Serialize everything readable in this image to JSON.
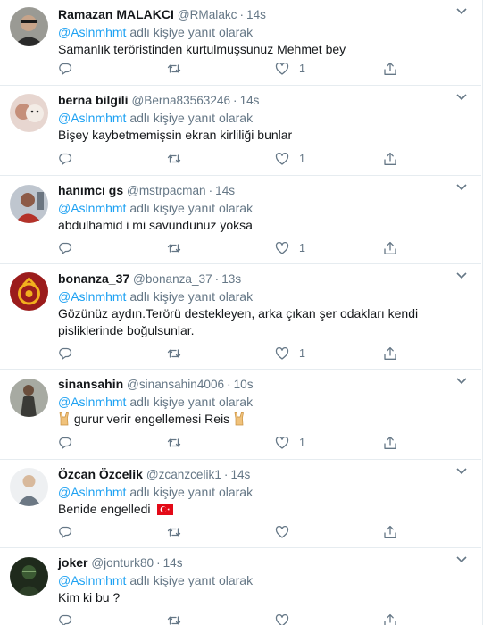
{
  "reply_prefix_suffix": "adlı kişiye yanıt olarak",
  "colors": {
    "accent": "#1da1f2",
    "muted": "#657786",
    "text": "#14171a",
    "divider": "#e6ecf0"
  },
  "tweets": [
    {
      "name": "Ramazan MALAKCI",
      "handle": "@RMalakc",
      "time": "14s",
      "reply_to": "@Aslnmhmt",
      "text": "Samanlık teröristinden kurtulmuşsunuz Mehmet bey",
      "likes": "1"
    },
    {
      "name": "berna bilgili",
      "handle": "@Berna83563246",
      "time": "14s",
      "reply_to": "@Aslnmhmt",
      "text": "Bişey kaybetmemişsin ekran kirliliği bunlar",
      "likes": "1"
    },
    {
      "name": "hanımcı gs",
      "handle": "@mstrpacman",
      "time": "14s",
      "reply_to": "@Aslnmhmt",
      "text": "abdulhamid i mi savundunuz yoksa",
      "likes": "1"
    },
    {
      "name": "bonanza_37",
      "handle": "@bonanza_37",
      "time": "13s",
      "reply_to": "@Aslnmhmt",
      "text": "Gözünüz aydın.Terörü destekleyen, arka çıkan şer odakları kendi pisliklerinde boğulsunlar.",
      "likes": "1"
    },
    {
      "name": "sinansahin",
      "handle": "@sinansahin4006",
      "time": "10s",
      "reply_to": "@Aslnmhmt",
      "text": "gurur verir engellemesi Reis",
      "likes": "1"
    },
    {
      "name": "Özcan Özcelik",
      "handle": "@zcanzcelik1",
      "time": "14s",
      "reply_to": "@Aslnmhmt",
      "text": "Benide engelledi",
      "likes": ""
    },
    {
      "name": "joker",
      "handle": "@jonturk80",
      "time": "14s",
      "reply_to": "@Aslnmhmt",
      "text": "Kim ki bu ?",
      "likes": ""
    }
  ]
}
